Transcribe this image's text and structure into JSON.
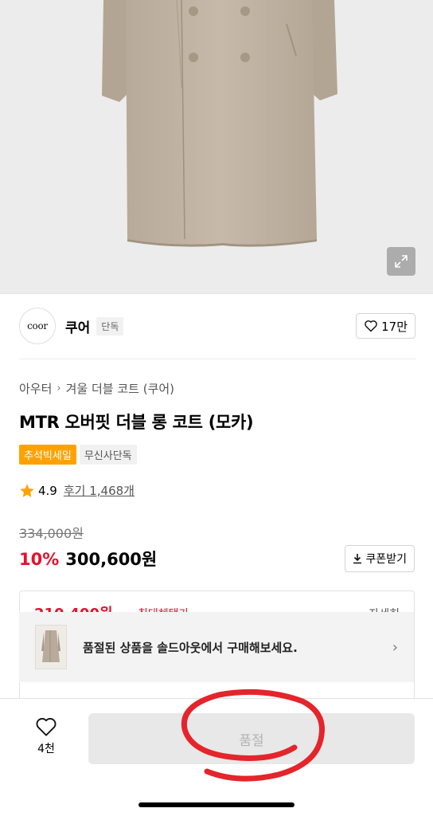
{
  "brand": {
    "logo_text": "coor",
    "name": "쿠어",
    "badge": "단독",
    "likes": "17만"
  },
  "breadcrumb": [
    "아우터",
    "겨울 더블 코트 (쿠어)"
  ],
  "product": {
    "title": "MTR 오버핏 더블 롱 코트 (모카)",
    "tags": [
      "추석빅세일",
      "무신사단독"
    ],
    "rating": "4.9",
    "reviews": "후기 1,468개",
    "original_price": "334,000원",
    "discount": "10%",
    "price": "300,600원",
    "coupon_label": "쿠폰받기"
  },
  "benefit": {
    "amount": "210,400원",
    "label": "최대혜택가",
    "right": "자세히"
  },
  "soldout_banner": {
    "text": "품절된 상품을 솔드아웃에서 구매해보세요."
  },
  "bottom_bar": {
    "wish_count": "4천",
    "soldout_label": "품절"
  },
  "colors": {
    "coat": "#c2b5a6",
    "accent_red": "#e8102d",
    "sale_orange": "#ffa200",
    "annotation_red": "#e4252b"
  },
  "icons": [
    "expand-icon",
    "heart-icon",
    "star-icon",
    "chevron-right-icon",
    "download-icon"
  ]
}
